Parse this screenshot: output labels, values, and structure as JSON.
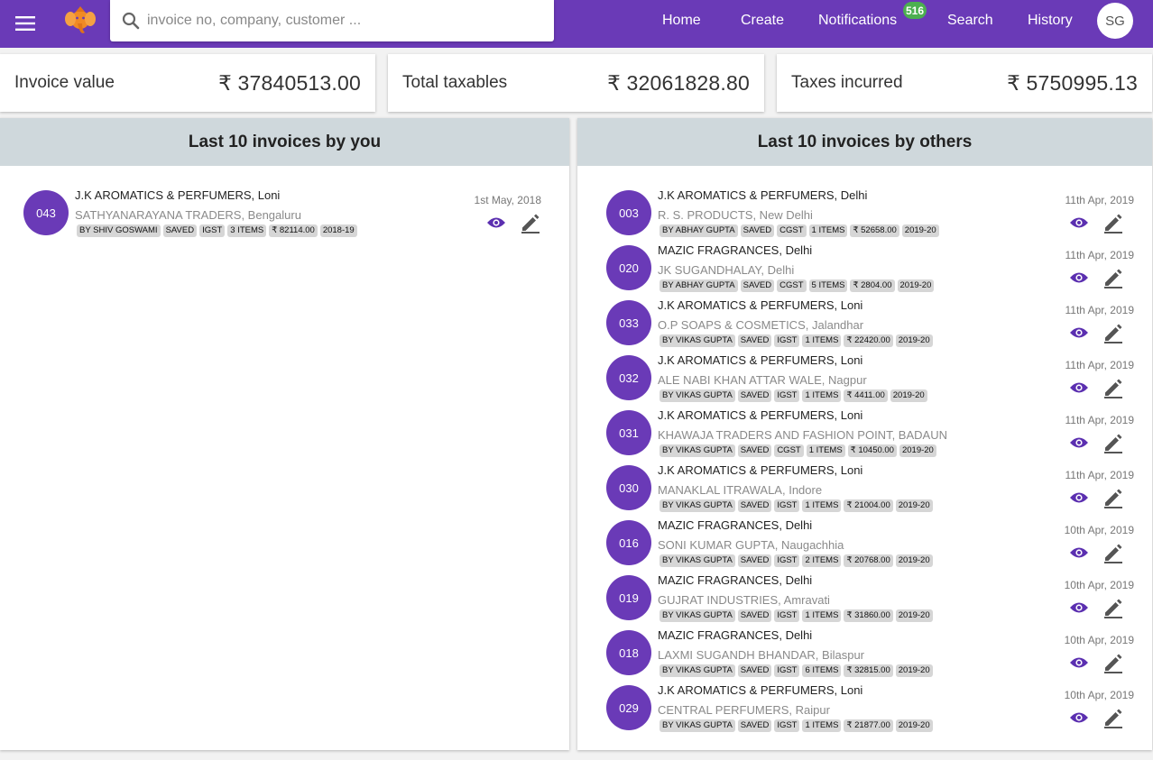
{
  "header": {
    "search_placeholder": "invoice no, company, customer ...",
    "nav": {
      "home": "Home",
      "create": "Create",
      "notifications": "Notifications",
      "search": "Search",
      "history": "History"
    },
    "notifications_count": "516",
    "user_initials": "SG"
  },
  "stats": {
    "invoice_value": {
      "label": "Invoice value",
      "value": "₹ 37840513.00"
    },
    "total_taxables": {
      "label": "Total taxables",
      "value": "₹ 32061828.80"
    },
    "taxes_incurred": {
      "label": "Taxes incurred",
      "value": "₹ 5750995.13"
    }
  },
  "left_panel": {
    "title": "Last 10 invoices by you",
    "invoices": [
      {
        "no": "043",
        "company": "J.K AROMATICS & PERFUMERS, Loni",
        "customer": "SATHYANARAYANA TRADERS, Bengaluru",
        "date": "1st May, 2018",
        "chips": [
          "BY SHIV GOSWAMI",
          "SAVED",
          "IGST",
          "3 ITEMS",
          "₹ 82114.00",
          "2018-19"
        ]
      }
    ]
  },
  "right_panel": {
    "title": "Last 10 invoices by others",
    "invoices": [
      {
        "no": "003",
        "company": "J.K AROMATICS & PERFUMERS, Delhi",
        "customer": "R. S. PRODUCTS, New Delhi",
        "date": "11th Apr, 2019",
        "chips": [
          "BY ABHAY GUPTA",
          "SAVED",
          "CGST",
          "1 ITEMS",
          "₹ 52658.00",
          "2019-20"
        ]
      },
      {
        "no": "020",
        "company": "MAZIC FRAGRANCES, Delhi",
        "customer": "JK SUGANDHALAY, Delhi",
        "date": "11th Apr, 2019",
        "chips": [
          "BY ABHAY GUPTA",
          "SAVED",
          "CGST",
          "5 ITEMS",
          "₹ 2804.00",
          "2019-20"
        ]
      },
      {
        "no": "033",
        "company": "J.K AROMATICS & PERFUMERS, Loni",
        "customer": "O.P SOAPS & COSMETICS, Jalandhar",
        "date": "11th Apr, 2019",
        "chips": [
          "BY VIKAS GUPTA",
          "SAVED",
          "IGST",
          "1 ITEMS",
          "₹ 22420.00",
          "2019-20"
        ]
      },
      {
        "no": "032",
        "company": "J.K AROMATICS & PERFUMERS, Loni",
        "customer": "ALE NABI KHAN ATTAR WALE, Nagpur",
        "date": "11th Apr, 2019",
        "chips": [
          "BY VIKAS GUPTA",
          "SAVED",
          "IGST",
          "1 ITEMS",
          "₹ 4411.00",
          "2019-20"
        ]
      },
      {
        "no": "031",
        "company": "J.K AROMATICS & PERFUMERS, Loni",
        "customer": "KHAWAJA TRADERS AND FASHION POINT, BADAUN",
        "date": "11th Apr, 2019",
        "chips": [
          "BY VIKAS GUPTA",
          "SAVED",
          "CGST",
          "1 ITEMS",
          "₹ 10450.00",
          "2019-20"
        ]
      },
      {
        "no": "030",
        "company": "J.K AROMATICS & PERFUMERS, Loni",
        "customer": "MANAKLAL ITRAWALA, Indore",
        "date": "11th Apr, 2019",
        "chips": [
          "BY VIKAS GUPTA",
          "SAVED",
          "IGST",
          "1 ITEMS",
          "₹ 21004.00",
          "2019-20"
        ]
      },
      {
        "no": "016",
        "company": "MAZIC FRAGRANCES, Delhi",
        "customer": "SONI KUMAR GUPTA, Naugachhia",
        "date": "10th Apr, 2019",
        "chips": [
          "BY VIKAS GUPTA",
          "SAVED",
          "IGST",
          "2 ITEMS",
          "₹ 20768.00",
          "2019-20"
        ]
      },
      {
        "no": "019",
        "company": "MAZIC FRAGRANCES, Delhi",
        "customer": "GUJRAT INDUSTRIES, Amravati",
        "date": "10th Apr, 2019",
        "chips": [
          "BY VIKAS GUPTA",
          "SAVED",
          "IGST",
          "1 ITEMS",
          "₹ 31860.00",
          "2019-20"
        ]
      },
      {
        "no": "018",
        "company": "MAZIC FRAGRANCES, Delhi",
        "customer": "LAXMI SUGANDH BHANDAR, Bilaspur",
        "date": "10th Apr, 2019",
        "chips": [
          "BY VIKAS GUPTA",
          "SAVED",
          "IGST",
          "6 ITEMS",
          "₹ 32815.00",
          "2019-20"
        ]
      },
      {
        "no": "029",
        "company": "J.K AROMATICS & PERFUMERS, Loni",
        "customer": "CENTRAL PERFUMERS, Raipur",
        "date": "10th Apr, 2019",
        "chips": [
          "BY VIKAS GUPTA",
          "SAVED",
          "IGST",
          "1 ITEMS",
          "₹ 21877.00",
          "2019-20"
        ]
      }
    ]
  },
  "icons": {
    "menu": "menu-icon",
    "logo": "ganesha-logo-icon",
    "search": "search-icon",
    "view": "eye-icon",
    "edit": "pencil-icon"
  },
  "colors": {
    "primary": "#6a3ab7",
    "badge": "#4caf50",
    "panel_header": "#cfd8dc",
    "chip": "#d6d6d6"
  }
}
